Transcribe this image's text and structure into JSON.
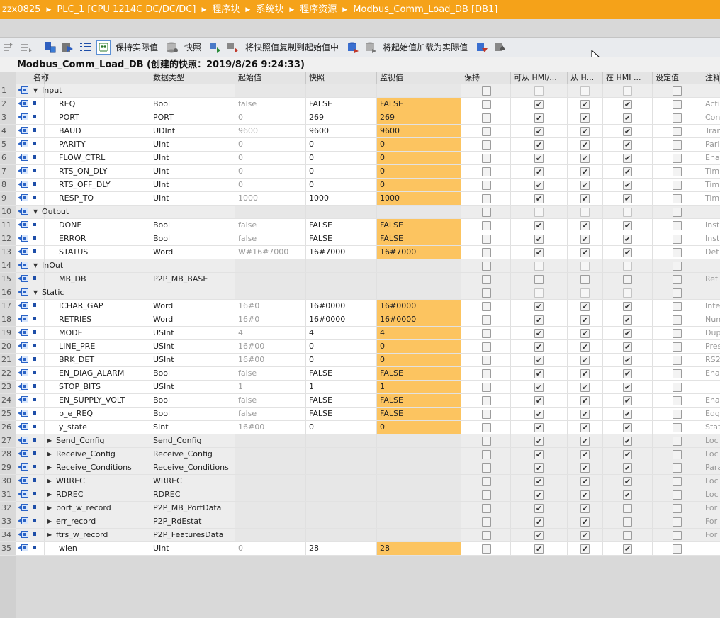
{
  "title_bar": {
    "crumbs": [
      "zzx0825",
      "PLC_1 [CPU 1214C DC/DC/DC]",
      "程序块",
      "系统块",
      "程序资源",
      "Modbus_Comm_Load_DB [DB1]"
    ],
    "separator": "▶"
  },
  "toolbar": {
    "keep_actual_label": "保持实际值",
    "snapshot_label": "快照",
    "copy_snapshot_label": "将快照值复制到起始值中",
    "load_start_label": "将起始值加载为实际值"
  },
  "db_title": "Modbus_Comm_Load_DB (创建的快照：2019/8/26 9:24:33)",
  "columns": {
    "name": "名称",
    "type": "数据类型",
    "start": "起始值",
    "snapshot": "快照",
    "monitor": "监视值",
    "retain": "保持",
    "hmi_access": "可从 HMI/...",
    "hmi_write": "从 H...",
    "hmi_visible": "在 HMI ...",
    "setpoint": "设定值",
    "comment": "注释"
  },
  "rows": [
    {
      "n": "1",
      "name": "Input",
      "indent": 0,
      "section": true,
      "exp": "▼",
      "type": "",
      "start": "",
      "snap": "",
      "mon": "",
      "hmi": [
        0,
        0,
        0
      ],
      "cmt": ""
    },
    {
      "n": "2",
      "name": "REQ",
      "indent": 2,
      "type": "Bool",
      "start": "false",
      "snap": "FALSE",
      "mon": "FALSE",
      "hmi": [
        1,
        1,
        1
      ],
      "cmt": "Acti"
    },
    {
      "n": "3",
      "name": "PORT",
      "indent": 2,
      "type": "PORT",
      "start": "0",
      "snap": "269",
      "mon": "269",
      "hmi": [
        1,
        1,
        1
      ],
      "cmt": "Con"
    },
    {
      "n": "4",
      "name": "BAUD",
      "indent": 2,
      "type": "UDInt",
      "start": "9600",
      "snap": "9600",
      "mon": "9600",
      "hmi": [
        1,
        1,
        1
      ],
      "cmt": "Tran"
    },
    {
      "n": "5",
      "name": "PARITY",
      "indent": 2,
      "type": "UInt",
      "start": "0",
      "snap": "0",
      "mon": "0",
      "hmi": [
        1,
        1,
        1
      ],
      "cmt": "Pari"
    },
    {
      "n": "6",
      "name": "FLOW_CTRL",
      "indent": 2,
      "type": "UInt",
      "start": "0",
      "snap": "0",
      "mon": "0",
      "hmi": [
        1,
        1,
        1
      ],
      "cmt": "Ena"
    },
    {
      "n": "7",
      "name": "RTS_ON_DLY",
      "indent": 2,
      "type": "UInt",
      "start": "0",
      "snap": "0",
      "mon": "0",
      "hmi": [
        1,
        1,
        1
      ],
      "cmt": "Tim"
    },
    {
      "n": "8",
      "name": "RTS_OFF_DLY",
      "indent": 2,
      "type": "UInt",
      "start": "0",
      "snap": "0",
      "mon": "0",
      "hmi": [
        1,
        1,
        1
      ],
      "cmt": "Tim"
    },
    {
      "n": "9",
      "name": "RESP_TO",
      "indent": 2,
      "type": "UInt",
      "start": "1000",
      "snap": "1000",
      "mon": "1000",
      "hmi": [
        1,
        1,
        1
      ],
      "cmt": "Tim"
    },
    {
      "n": "10",
      "name": "Output",
      "indent": 0,
      "section": true,
      "exp": "▼",
      "type": "",
      "start": "",
      "snap": "",
      "mon": "",
      "hmi": [
        0,
        0,
        0
      ],
      "cmt": ""
    },
    {
      "n": "11",
      "name": "DONE",
      "indent": 2,
      "type": "Bool",
      "start": "false",
      "snap": "FALSE",
      "mon": "FALSE",
      "hmi": [
        1,
        1,
        1
      ],
      "cmt": "Inst"
    },
    {
      "n": "12",
      "name": "ERROR",
      "indent": 2,
      "type": "Bool",
      "start": "false",
      "snap": "FALSE",
      "mon": "FALSE",
      "hmi": [
        1,
        1,
        1
      ],
      "cmt": "Inst"
    },
    {
      "n": "13",
      "name": "STATUS",
      "indent": 2,
      "type": "Word",
      "start": "W#16#7000",
      "snap": "16#7000",
      "mon": "16#7000",
      "hmi": [
        1,
        1,
        1
      ],
      "cmt": "Det"
    },
    {
      "n": "14",
      "name": "InOut",
      "indent": 0,
      "section": true,
      "exp": "▼",
      "type": "",
      "start": "",
      "snap": "",
      "mon": "",
      "hmi": [
        0,
        0,
        0
      ],
      "cmt": ""
    },
    {
      "n": "15",
      "name": "MB_DB",
      "indent": 2,
      "type": "P2P_MB_BASE",
      "start": "",
      "snap": "",
      "mon": "",
      "hmi": [
        0,
        0,
        0
      ],
      "cmt": "Ref"
    },
    {
      "n": "16",
      "name": "Static",
      "indent": 0,
      "section": true,
      "exp": "▼",
      "type": "",
      "start": "",
      "snap": "",
      "mon": "",
      "hmi": [
        0,
        0,
        0
      ],
      "cmt": ""
    },
    {
      "n": "17",
      "name": "ICHAR_GAP",
      "indent": 2,
      "type": "Word",
      "start": "16#0",
      "snap": "16#0000",
      "mon": "16#0000",
      "hmi": [
        1,
        1,
        1
      ],
      "cmt": "Inte"
    },
    {
      "n": "18",
      "name": "RETRIES",
      "indent": 2,
      "type": "Word",
      "start": "16#0",
      "snap": "16#0000",
      "mon": "16#0000",
      "hmi": [
        1,
        1,
        1
      ],
      "cmt": "Nun"
    },
    {
      "n": "19",
      "name": "MODE",
      "indent": 2,
      "type": "USInt",
      "start": "4",
      "snap": "4",
      "mon": "4",
      "hmi": [
        1,
        1,
        1
      ],
      "cmt": "Dup"
    },
    {
      "n": "20",
      "name": "LINE_PRE",
      "indent": 2,
      "type": "USInt",
      "start": "16#00",
      "snap": "0",
      "mon": "0",
      "hmi": [
        1,
        1,
        1
      ],
      "cmt": "Pres"
    },
    {
      "n": "21",
      "name": "BRK_DET",
      "indent": 2,
      "type": "USInt",
      "start": "16#00",
      "snap": "0",
      "mon": "0",
      "hmi": [
        1,
        1,
        1
      ],
      "cmt": "RS2"
    },
    {
      "n": "22",
      "name": "EN_DIAG_ALARM",
      "indent": 2,
      "type": "Bool",
      "start": "false",
      "snap": "FALSE",
      "mon": "FALSE",
      "hmi": [
        1,
        1,
        1
      ],
      "cmt": "Ena"
    },
    {
      "n": "23",
      "name": "STOP_BITS",
      "indent": 2,
      "type": "USInt",
      "start": "1",
      "snap": "1",
      "mon": "1",
      "hmi": [
        1,
        1,
        1
      ],
      "cmt": ""
    },
    {
      "n": "24",
      "name": "EN_SUPPLY_VOLT",
      "indent": 2,
      "type": "Bool",
      "start": "false",
      "snap": "FALSE",
      "mon": "FALSE",
      "hmi": [
        1,
        1,
        1
      ],
      "cmt": "Ena"
    },
    {
      "n": "25",
      "name": "b_e_REQ",
      "indent": 2,
      "type": "Bool",
      "start": "false",
      "snap": "FALSE",
      "mon": "FALSE",
      "hmi": [
        1,
        1,
        1
      ],
      "cmt": "Edg"
    },
    {
      "n": "26",
      "name": "y_state",
      "indent": 2,
      "type": "SInt",
      "start": "16#00",
      "snap": "0",
      "mon": "0",
      "hmi": [
        1,
        1,
        1
      ],
      "cmt": "Stat"
    },
    {
      "n": "27",
      "name": "Send_Config",
      "indent": 1,
      "exp": "▶",
      "type": "Send_Config",
      "start": "",
      "snap": "",
      "mon": "",
      "hmi": [
        1,
        1,
        1
      ],
      "cmt": "Loc"
    },
    {
      "n": "28",
      "name": "Receive_Config",
      "indent": 1,
      "exp": "▶",
      "type": "Receive_Config",
      "start": "",
      "snap": "",
      "mon": "",
      "hmi": [
        1,
        1,
        1
      ],
      "cmt": "Loc"
    },
    {
      "n": "29",
      "name": "Receive_Conditions",
      "indent": 1,
      "exp": "▶",
      "type": "Receive_Conditions",
      "start": "",
      "snap": "",
      "mon": "",
      "hmi": [
        1,
        1,
        1
      ],
      "cmt": "Para"
    },
    {
      "n": "30",
      "name": "WRREC",
      "indent": 1,
      "exp": "▶",
      "type": "WRREC",
      "start": "",
      "snap": "",
      "mon": "",
      "hmi": [
        1,
        1,
        1
      ],
      "cmt": "Loc"
    },
    {
      "n": "31",
      "name": "RDREC",
      "indent": 1,
      "exp": "▶",
      "type": "RDREC",
      "start": "",
      "snap": "",
      "mon": "",
      "hmi": [
        1,
        1,
        1
      ],
      "cmt": "Loc"
    },
    {
      "n": "32",
      "name": "port_w_record",
      "indent": 1,
      "exp": "▶",
      "type": "P2P_MB_PortData",
      "start": "",
      "snap": "",
      "mon": "",
      "hmi": [
        1,
        1,
        0
      ],
      "cmt": "For"
    },
    {
      "n": "33",
      "name": "err_record",
      "indent": 1,
      "exp": "▶",
      "type": "P2P_RdEstat",
      "start": "",
      "snap": "",
      "mon": "",
      "hmi": [
        1,
        1,
        0
      ],
      "cmt": "For"
    },
    {
      "n": "34",
      "name": "ftrs_w_record",
      "indent": 1,
      "exp": "▶",
      "type": "P2P_FeaturesData",
      "start": "",
      "snap": "",
      "mon": "",
      "hmi": [
        1,
        1,
        0
      ],
      "cmt": "For"
    },
    {
      "n": "35",
      "name": "wlen",
      "indent": 2,
      "type": "UInt",
      "start": "0",
      "snap": "28",
      "mon": "28",
      "hmi": [
        1,
        1,
        1
      ],
      "cmt": ""
    }
  ],
  "colors": {
    "accent": "#f5a219",
    "monitor_highlight": "#fcc460",
    "io_icon": "#2a63c7"
  }
}
